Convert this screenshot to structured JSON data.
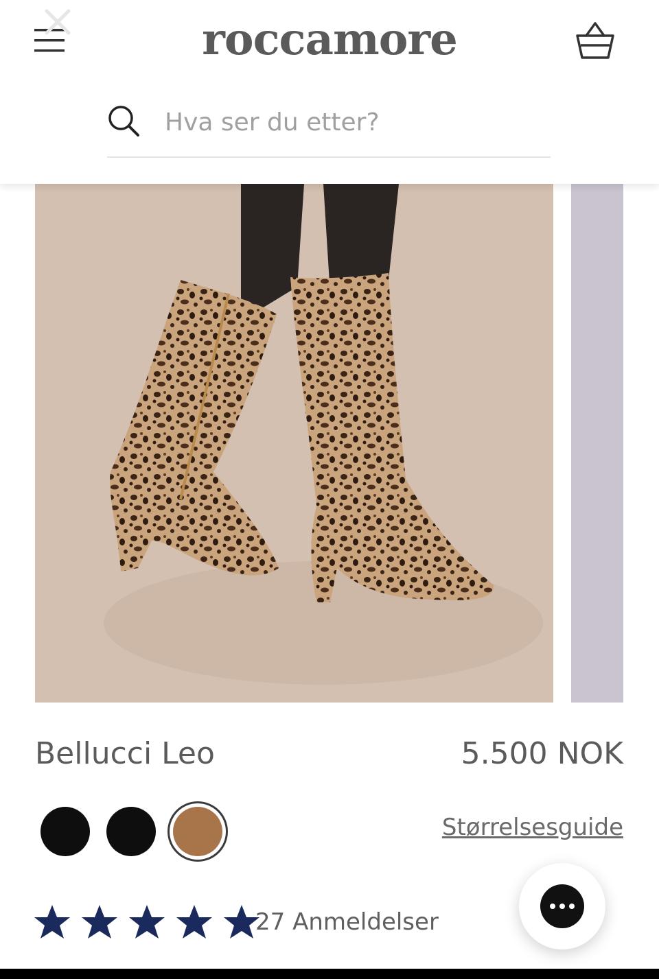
{
  "header": {
    "logo": "roccamore",
    "menu_icon": "hamburger-icon",
    "close_icon": "close-icon",
    "cart_icon": "basket-icon"
  },
  "search": {
    "placeholder": "Hva ser du etter?",
    "icon": "search-icon"
  },
  "product": {
    "name": "Bellucci Leo",
    "price": "5.500 NOK",
    "image_icon": "leopard-boots-photo",
    "swatches": [
      {
        "color": "#0e0e0e",
        "selected": false
      },
      {
        "color": "#0e0e0e",
        "selected": false
      },
      {
        "color": "#a8744a",
        "selected": true
      }
    ],
    "size_guide_label": "Størrelsesguide",
    "rating": {
      "stars": 5,
      "max": 5,
      "color": "#1b2a5c"
    },
    "reviews_label": "27 Anmeldelser"
  },
  "chat": {
    "icon": "chat-bubble-icon"
  }
}
